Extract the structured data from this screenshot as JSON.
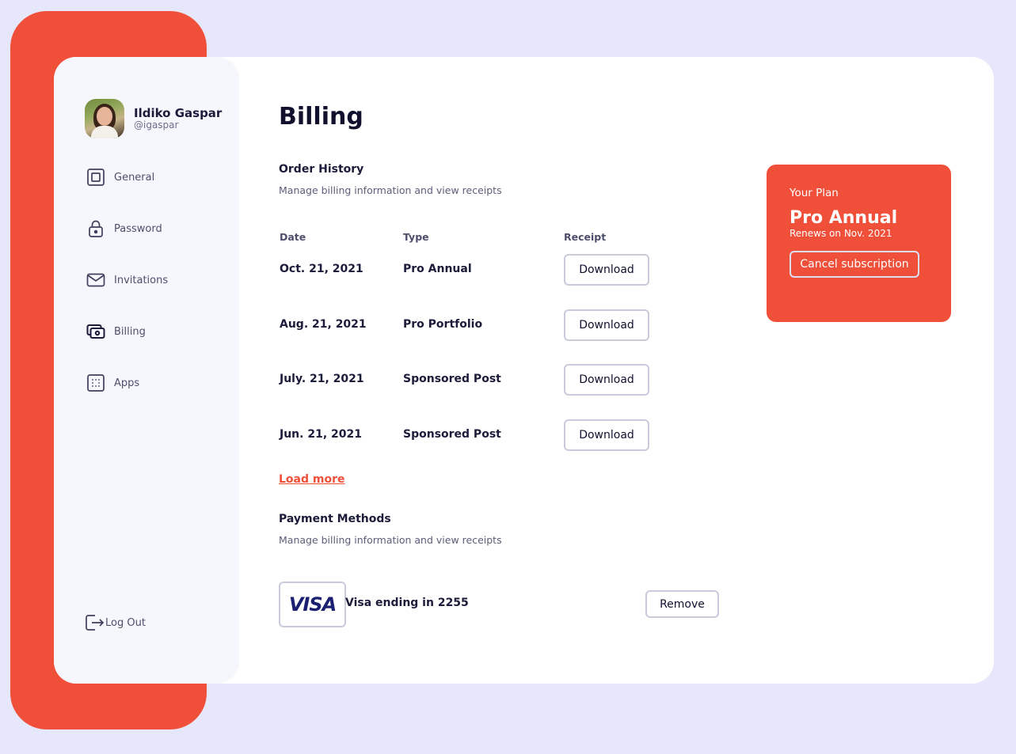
{
  "user": {
    "name": "Ildiko Gaspar",
    "handle": "@igaspar"
  },
  "nav": [
    {
      "label": "General",
      "icon": "square-icon"
    },
    {
      "label": "Password",
      "icon": "lock-icon"
    },
    {
      "label": "Invitations",
      "icon": "mail-icon"
    },
    {
      "label": "Billing",
      "icon": "wallet-icon"
    },
    {
      "label": "Apps",
      "icon": "apps-grid-icon"
    }
  ],
  "logout_label": "Log Out",
  "page": {
    "title": "Billing"
  },
  "order_history": {
    "title": "Order History",
    "subtitle": "Manage billing information and view receipts",
    "columns": [
      "Date",
      "Type",
      "Receipt"
    ],
    "rows": [
      {
        "date": "Oct. 21, 2021",
        "type": "Pro Annual",
        "receipt": "Download"
      },
      {
        "date": "Aug. 21, 2021",
        "type": "Pro Portfolio",
        "receipt": "Download"
      },
      {
        "date": "July. 21, 2021",
        "type": "Sponsored Post",
        "receipt": "Download"
      },
      {
        "date": "Jun. 21, 2021",
        "type": "Sponsored Post",
        "receipt": "Download"
      }
    ],
    "load_more": "Load more"
  },
  "payment_methods": {
    "title": "Payment Methods",
    "subtitle": "Manage billing information and view receipts",
    "card_brand": "VISA",
    "card_text": "Visa ending in 2255",
    "remove_label": "Remove"
  },
  "plan": {
    "label": "Your Plan",
    "name": "Pro Annual",
    "renews": "Renews on Nov. 2021",
    "cancel_label": "Cancel subscription"
  },
  "colors": {
    "accent": "#f0503a",
    "background": "#e6e7fa",
    "sidebar": "#f6f7fd",
    "text": "#1b1b3a",
    "border": "#c9cbdb"
  }
}
